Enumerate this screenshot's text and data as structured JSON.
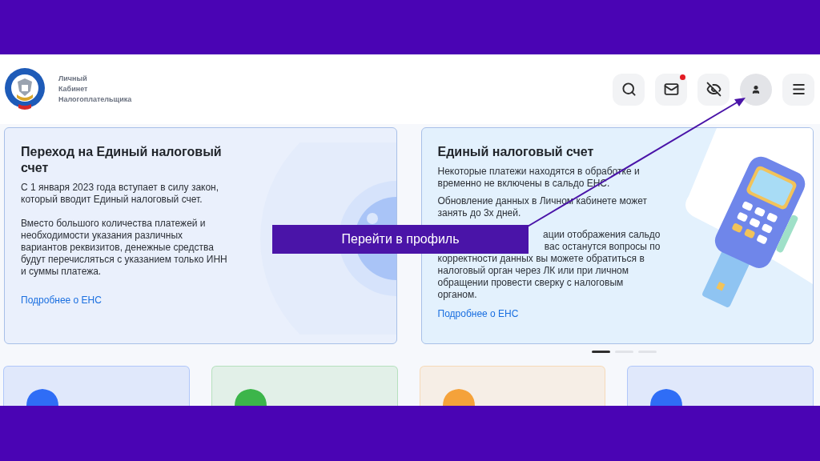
{
  "header": {
    "logo_text": [
      "Личный",
      "Кабинет",
      "Налогоплательщика"
    ],
    "buttons": [
      {
        "kind": "search",
        "badge": false,
        "selected": false
      },
      {
        "kind": "mail",
        "badge": true,
        "selected": false
      },
      {
        "kind": "eye-off",
        "badge": false,
        "selected": false
      },
      {
        "kind": "user",
        "badge": false,
        "selected": true
      },
      {
        "kind": "menu",
        "badge": false,
        "selected": false
      }
    ]
  },
  "cards": [
    {
      "title": "Переход на Единый налоговый счет",
      "paragraphs": [
        {
          "kind": "plain",
          "text": "С 1 января 2023 года вступает в силу закон, который вводит Единый налоговый счет."
        },
        {
          "kind": "plain",
          "text": "Вместо большого количества платежей и необходимости указания различных вариантов реквизитов, денежные средства будут перечисляться с указанием только ИНН и суммы платежа."
        }
      ],
      "link": "Подробнее о ЕНС",
      "kind": "circles"
    },
    {
      "title": "Единый налоговый счет",
      "paragraphs": [
        {
          "kind": "plain",
          "text": "Некоторые платежи находятся в обработке и временно не включены в сальдо ЕНС."
        },
        {
          "kind": "plain",
          "text": "Обновление данных в Личном кабинете может занять до 3х дней."
        },
        {
          "kind": "covered",
          "fragments": [
            "ации отображения сальдо",
            "вас останутся вопросы по"
          ],
          "text": "корректности данных вы можете обратиться в налоговый орган через ЛК или при личном обращении провести сверку с налоговым органом."
        }
      ],
      "link": "Подробнее о ЕНС",
      "kind": "terminal"
    }
  ],
  "carousel_dots": [
    {
      "selected": true
    },
    {
      "selected": false
    },
    {
      "selected": false
    }
  ],
  "tiles": [
    {
      "color": "#2f6df6"
    },
    {
      "color": "#3cb54a"
    },
    {
      "color": "#f5a23a"
    },
    {
      "color": "#2f6df6"
    }
  ],
  "overlay": {
    "label": "Перейти в профиль"
  }
}
